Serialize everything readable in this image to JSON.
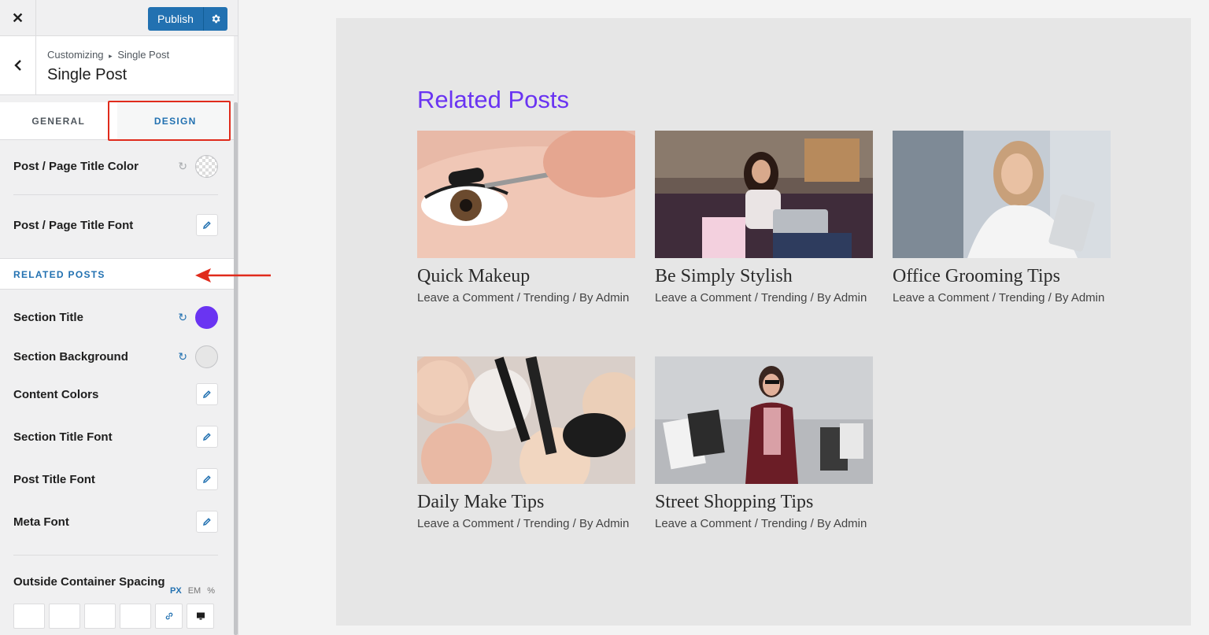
{
  "topbar": {
    "close_label": "✕",
    "publish_label": "Publish"
  },
  "section": {
    "breadcrumb_root": "Customizing",
    "breadcrumb_sep": "▸",
    "breadcrumb_current": "Single Post",
    "title": "Single Post"
  },
  "tabs": [
    {
      "label": "GENERAL"
    },
    {
      "label": "DESIGN"
    }
  ],
  "controls": {
    "title_color": "Post / Page Title Color",
    "title_font": "Post / Page Title Font",
    "related_head": "RELATED POSTS",
    "section_title": "Section Title",
    "section_background": "Section Background",
    "content_colors": "Content Colors",
    "section_title_font": "Section Title Font",
    "post_title_font": "Post Title Font",
    "meta_font": "Meta Font",
    "outside_spacing": "Outside Container Spacing"
  },
  "units": {
    "px": "PX",
    "em": "EM",
    "pct": "%"
  },
  "colors": {
    "section_title": "#6a34f2",
    "section_background": "#e6e6e6",
    "accent": "#2271b1"
  },
  "preview": {
    "heading": "Related Posts",
    "posts": [
      {
        "title": "Quick Makeup",
        "comment": "Leave a Comment",
        "sep1": " / ",
        "category": "Trending",
        "sep2": " / By ",
        "author": "Admin",
        "image": "eye-mascara-photo"
      },
      {
        "title": "Be Simply Stylish",
        "comment": "Leave a Comment",
        "sep1": " / ",
        "category": "Trending",
        "sep2": " / By ",
        "author": "Admin",
        "image": "woman-laptop-shopping-photo"
      },
      {
        "title": "Office Grooming Tips",
        "comment": "Leave a Comment",
        "sep1": " / ",
        "category": "Trending",
        "sep2": " / By ",
        "author": "Admin",
        "image": "woman-phone-tablet-photo"
      },
      {
        "title": "Daily Make Tips",
        "comment": "Leave a Comment",
        "sep1": " / ",
        "category": "Trending",
        "sep2": " / By ",
        "author": "Admin",
        "image": "makeup-powder-brushes-photo"
      },
      {
        "title": "Street Shopping Tips",
        "comment": "Leave a Comment",
        "sep1": " / ",
        "category": "Trending",
        "sep2": " / By ",
        "author": "Admin",
        "image": "woman-shopping-bags-photo"
      }
    ]
  }
}
